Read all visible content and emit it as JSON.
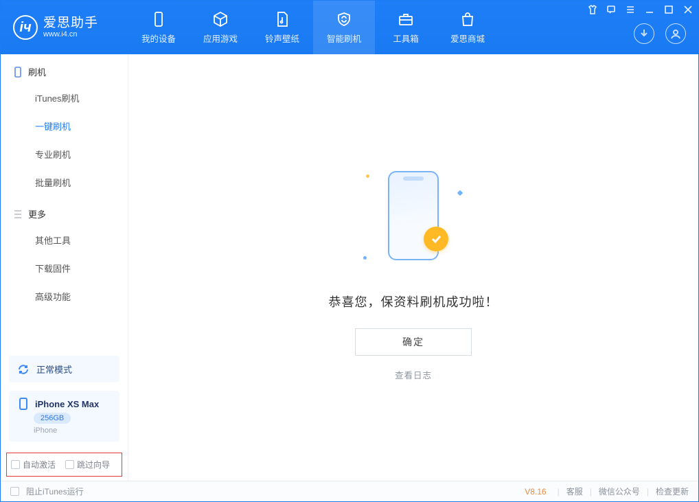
{
  "app": {
    "name_cn": "爱思助手",
    "url": "www.i4.cn"
  },
  "nav": {
    "items": [
      {
        "label": "我的设备"
      },
      {
        "label": "应用游戏"
      },
      {
        "label": "铃声壁纸"
      },
      {
        "label": "智能刷机"
      },
      {
        "label": "工具箱"
      },
      {
        "label": "爱思商城"
      }
    ],
    "active_index": 3
  },
  "sidebar": {
    "section_flash": "刷机",
    "flash_items": [
      {
        "label": "iTunes刷机"
      },
      {
        "label": "一键刷机"
      },
      {
        "label": "专业刷机"
      },
      {
        "label": "批量刷机"
      }
    ],
    "flash_active_index": 1,
    "section_more": "更多",
    "more_items": [
      {
        "label": "其他工具"
      },
      {
        "label": "下载固件"
      },
      {
        "label": "高级功能"
      }
    ],
    "mode_label": "正常模式",
    "device": {
      "name": "iPhone XS Max",
      "capacity": "256GB",
      "type": "iPhone"
    },
    "options": {
      "auto_activate": "自动激活",
      "skip_guide": "跳过向导"
    }
  },
  "main": {
    "success_text": "恭喜您，保资料刷机成功啦！",
    "ok": "确定",
    "view_log": "查看日志"
  },
  "statusbar": {
    "block_itunes": "阻止iTunes运行",
    "version": "V8.16",
    "links": {
      "kefu": "客服",
      "wechat": "微信公众号",
      "update": "检查更新"
    }
  }
}
